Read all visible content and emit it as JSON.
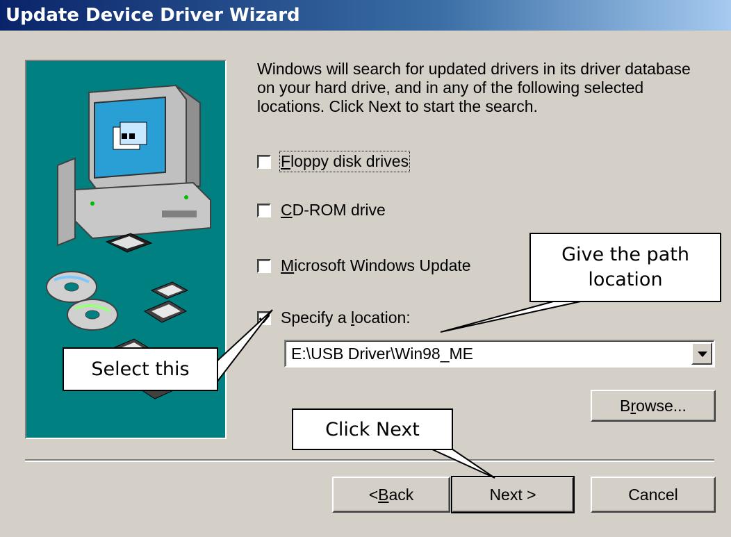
{
  "window": {
    "title": "Update Device Driver Wizard"
  },
  "description": "Windows will search for updated drivers in its driver database on your hard drive, and in any of the following selected locations. Click Next to start the search.",
  "options": [
    {
      "pre": "",
      "key": "F",
      "post": "loppy disk drives",
      "checked": false
    },
    {
      "pre": "",
      "key": "C",
      "post": "D-ROM drive",
      "checked": false
    },
    {
      "pre": "",
      "key": "M",
      "post": "icrosoft Windows Update",
      "checked": false
    },
    {
      "pre": "Specify a ",
      "key": "l",
      "post": "ocation:",
      "checked": true
    }
  ],
  "location": {
    "value": "E:\\USB Driver\\Win98_ME"
  },
  "buttons": {
    "browse": {
      "pre": "B",
      "key": "r",
      "post": "owse..."
    },
    "back": {
      "pre": "< ",
      "key": "B",
      "post": "ack"
    },
    "next": "Next >",
    "cancel": "Cancel"
  },
  "callouts": {
    "path": "Give the path location",
    "select": "Select this",
    "next": "Click Next"
  },
  "colors": {
    "titlebar": "#0a246a",
    "panel": "#008080",
    "face": "#d4d0c8"
  }
}
